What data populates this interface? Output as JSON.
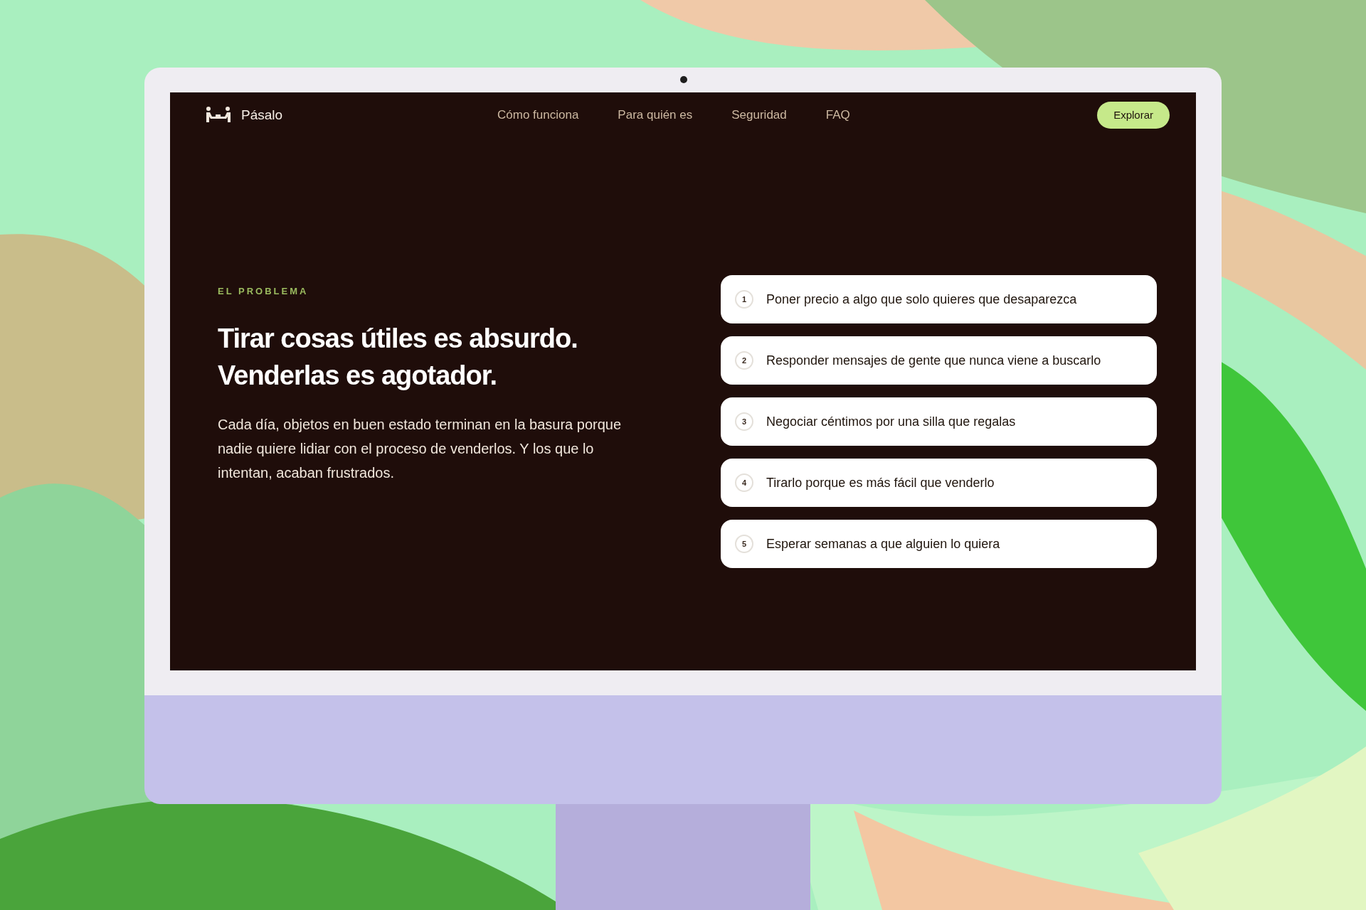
{
  "nav": {
    "brand": "Pásalo",
    "links": [
      "Cómo funciona",
      "Para quién es",
      "Seguridad",
      "FAQ"
    ],
    "cta": "Explorar"
  },
  "hero": {
    "eyebrow": "EL PROBLEMA",
    "title_lines": [
      "Tirar cosas útiles es absurdo.",
      "Venderlas es agotador."
    ],
    "body": "Cada día, objetos en buen estado terminan en la basura porque nadie quiere lidiar con el proceso de venderlos. Y los que lo intentan, acaban frustrados."
  },
  "problems": [
    {
      "number": "1",
      "text": "Poner precio a algo que solo quieres que desaparezca"
    },
    {
      "number": "2",
      "text": "Responder mensajes de gente que nunca viene a buscarlo"
    },
    {
      "number": "3",
      "text": "Negociar céntimos por una silla que regalas"
    },
    {
      "number": "4",
      "text": "Tirarlo porque es más fácil que venderlo"
    },
    {
      "number": "5",
      "text": "Esperar semanas a que alguien lo quiera"
    }
  ]
}
